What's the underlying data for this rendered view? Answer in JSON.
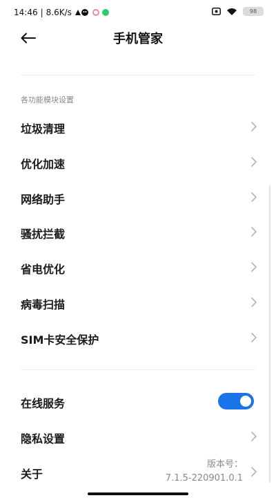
{
  "status_bar": {
    "time": "14:46",
    "separator": "|",
    "speed": "8.6K/s",
    "battery": "98",
    "notif_color": "#f08aa0",
    "notif2_color": "#2ecc71"
  },
  "header": {
    "title": "手机管家",
    "back_icon": "arrow-left-icon"
  },
  "section": {
    "title": "各功能模块设置"
  },
  "items": [
    {
      "label": "垃圾清理"
    },
    {
      "label": "优化加速"
    },
    {
      "label": "网络助手"
    },
    {
      "label": "骚扰拦截"
    },
    {
      "label": "省电优化"
    },
    {
      "label": "病毒扫描"
    },
    {
      "label": "SIM卡安全保护"
    }
  ],
  "settings": {
    "online_service": {
      "label": "在线服务",
      "enabled": true
    },
    "privacy": {
      "label": "隐私设置"
    },
    "about": {
      "label": "关于",
      "version_label": "版本号：",
      "version": "7.1.5-220901.0.1"
    }
  },
  "colors": {
    "toggle_on": "#1a73e8",
    "label_gray": "#888888"
  }
}
